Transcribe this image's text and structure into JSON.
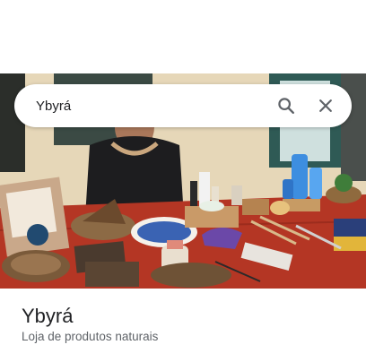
{
  "search": {
    "query": "Ybyrá"
  },
  "place": {
    "name": "Ybyrá",
    "category": "Loja de produtos naturais"
  },
  "photo": {
    "icon": "storefront-photo"
  },
  "icons": {
    "search": "search-icon",
    "close": "close-icon"
  },
  "colors": {
    "accent": "#5f6368",
    "text_primary": "#202124",
    "text_secondary": "#5f6368"
  }
}
